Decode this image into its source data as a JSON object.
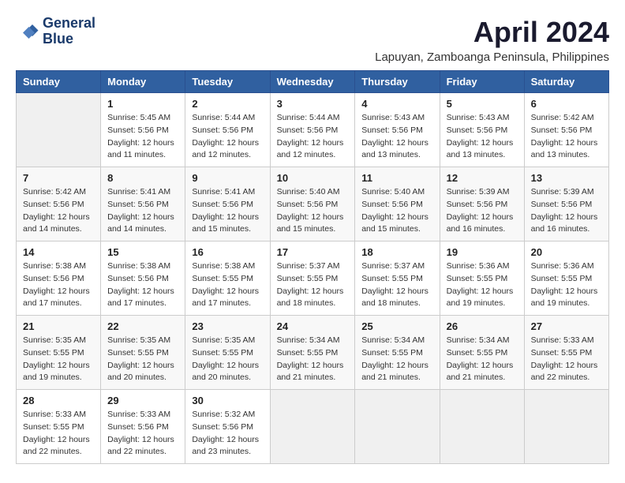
{
  "logo": {
    "line1": "General",
    "line2": "Blue"
  },
  "title": "April 2024",
  "location": "Lapuyan, Zamboanga Peninsula, Philippines",
  "days_header": [
    "Sunday",
    "Monday",
    "Tuesday",
    "Wednesday",
    "Thursday",
    "Friday",
    "Saturday"
  ],
  "weeks": [
    [
      {
        "day": "",
        "info": ""
      },
      {
        "day": "1",
        "info": "Sunrise: 5:45 AM\nSunset: 5:56 PM\nDaylight: 12 hours\nand 11 minutes."
      },
      {
        "day": "2",
        "info": "Sunrise: 5:44 AM\nSunset: 5:56 PM\nDaylight: 12 hours\nand 12 minutes."
      },
      {
        "day": "3",
        "info": "Sunrise: 5:44 AM\nSunset: 5:56 PM\nDaylight: 12 hours\nand 12 minutes."
      },
      {
        "day": "4",
        "info": "Sunrise: 5:43 AM\nSunset: 5:56 PM\nDaylight: 12 hours\nand 13 minutes."
      },
      {
        "day": "5",
        "info": "Sunrise: 5:43 AM\nSunset: 5:56 PM\nDaylight: 12 hours\nand 13 minutes."
      },
      {
        "day": "6",
        "info": "Sunrise: 5:42 AM\nSunset: 5:56 PM\nDaylight: 12 hours\nand 13 minutes."
      }
    ],
    [
      {
        "day": "7",
        "info": "Sunrise: 5:42 AM\nSunset: 5:56 PM\nDaylight: 12 hours\nand 14 minutes."
      },
      {
        "day": "8",
        "info": "Sunrise: 5:41 AM\nSunset: 5:56 PM\nDaylight: 12 hours\nand 14 minutes."
      },
      {
        "day": "9",
        "info": "Sunrise: 5:41 AM\nSunset: 5:56 PM\nDaylight: 12 hours\nand 15 minutes."
      },
      {
        "day": "10",
        "info": "Sunrise: 5:40 AM\nSunset: 5:56 PM\nDaylight: 12 hours\nand 15 minutes."
      },
      {
        "day": "11",
        "info": "Sunrise: 5:40 AM\nSunset: 5:56 PM\nDaylight: 12 hours\nand 15 minutes."
      },
      {
        "day": "12",
        "info": "Sunrise: 5:39 AM\nSunset: 5:56 PM\nDaylight: 12 hours\nand 16 minutes."
      },
      {
        "day": "13",
        "info": "Sunrise: 5:39 AM\nSunset: 5:56 PM\nDaylight: 12 hours\nand 16 minutes."
      }
    ],
    [
      {
        "day": "14",
        "info": "Sunrise: 5:38 AM\nSunset: 5:56 PM\nDaylight: 12 hours\nand 17 minutes."
      },
      {
        "day": "15",
        "info": "Sunrise: 5:38 AM\nSunset: 5:56 PM\nDaylight: 12 hours\nand 17 minutes."
      },
      {
        "day": "16",
        "info": "Sunrise: 5:38 AM\nSunset: 5:55 PM\nDaylight: 12 hours\nand 17 minutes."
      },
      {
        "day": "17",
        "info": "Sunrise: 5:37 AM\nSunset: 5:55 PM\nDaylight: 12 hours\nand 18 minutes."
      },
      {
        "day": "18",
        "info": "Sunrise: 5:37 AM\nSunset: 5:55 PM\nDaylight: 12 hours\nand 18 minutes."
      },
      {
        "day": "19",
        "info": "Sunrise: 5:36 AM\nSunset: 5:55 PM\nDaylight: 12 hours\nand 19 minutes."
      },
      {
        "day": "20",
        "info": "Sunrise: 5:36 AM\nSunset: 5:55 PM\nDaylight: 12 hours\nand 19 minutes."
      }
    ],
    [
      {
        "day": "21",
        "info": "Sunrise: 5:35 AM\nSunset: 5:55 PM\nDaylight: 12 hours\nand 19 minutes."
      },
      {
        "day": "22",
        "info": "Sunrise: 5:35 AM\nSunset: 5:55 PM\nDaylight: 12 hours\nand 20 minutes."
      },
      {
        "day": "23",
        "info": "Sunrise: 5:35 AM\nSunset: 5:55 PM\nDaylight: 12 hours\nand 20 minutes."
      },
      {
        "day": "24",
        "info": "Sunrise: 5:34 AM\nSunset: 5:55 PM\nDaylight: 12 hours\nand 21 minutes."
      },
      {
        "day": "25",
        "info": "Sunrise: 5:34 AM\nSunset: 5:55 PM\nDaylight: 12 hours\nand 21 minutes."
      },
      {
        "day": "26",
        "info": "Sunrise: 5:34 AM\nSunset: 5:55 PM\nDaylight: 12 hours\nand 21 minutes."
      },
      {
        "day": "27",
        "info": "Sunrise: 5:33 AM\nSunset: 5:55 PM\nDaylight: 12 hours\nand 22 minutes."
      }
    ],
    [
      {
        "day": "28",
        "info": "Sunrise: 5:33 AM\nSunset: 5:55 PM\nDaylight: 12 hours\nand 22 minutes."
      },
      {
        "day": "29",
        "info": "Sunrise: 5:33 AM\nSunset: 5:56 PM\nDaylight: 12 hours\nand 22 minutes."
      },
      {
        "day": "30",
        "info": "Sunrise: 5:32 AM\nSunset: 5:56 PM\nDaylight: 12 hours\nand 23 minutes."
      },
      {
        "day": "",
        "info": ""
      },
      {
        "day": "",
        "info": ""
      },
      {
        "day": "",
        "info": ""
      },
      {
        "day": "",
        "info": ""
      }
    ]
  ]
}
